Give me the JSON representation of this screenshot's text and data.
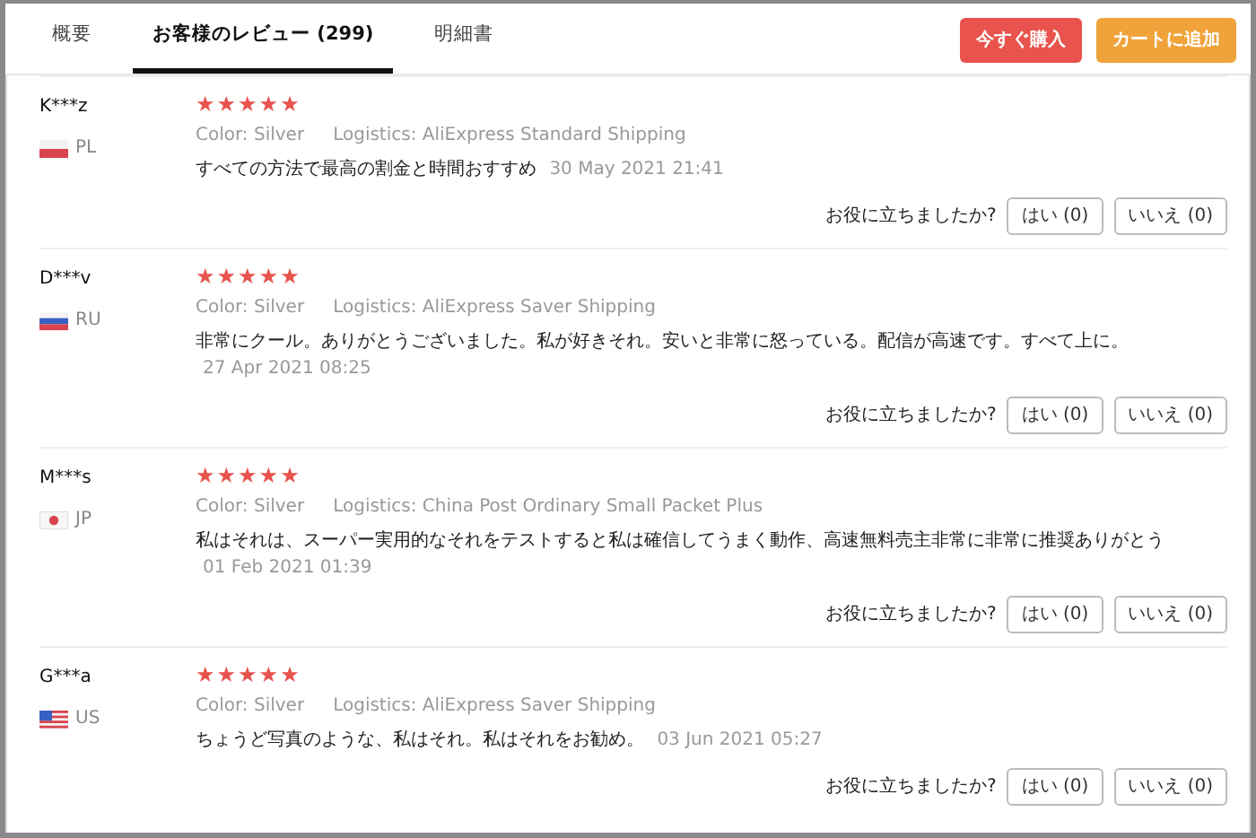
{
  "tabs": [
    {
      "label": "概要",
      "selected": false
    },
    {
      "label": "お客様のレビュー (299)",
      "selected": true
    },
    {
      "label": "明細書",
      "selected": false
    }
  ],
  "actions": [
    {
      "label": "今すぐ購入",
      "kind": "buy"
    },
    {
      "label": "カートに追加",
      "kind": "cart"
    }
  ],
  "reviews": [
    {
      "name": "K***z",
      "kind": "pl",
      "country": "PL",
      "stars": 5,
      "variant": "Color: Silver",
      "logistics": "Logistics: AliExpress Standard Shipping",
      "text": "すべての方法で最高の割金と時間おすすめ",
      "date": "30 May 2021 21:41",
      "helpful": "お役に立ちましたか?",
      "yes": "はい (0)",
      "no": "いいえ (0)"
    },
    {
      "name": "D***v",
      "kind": "ru",
      "country": "RU",
      "stars": 5,
      "variant": "Color: Silver",
      "logistics": "Logistics: AliExpress Saver Shipping",
      "text": "非常にクール。ありがとうございました。私が好きそれ。安いと非常に怒っている。配信が高速です。すべて上に。",
      "date": "27 Apr 2021 08:25",
      "helpful": "お役に立ちましたか?",
      "yes": "はい (0)",
      "no": "いいえ (0)"
    },
    {
      "name": "M***s",
      "kind": "jp",
      "country": "JP",
      "stars": 5,
      "variant": "Color: Silver",
      "logistics": "Logistics: China Post Ordinary Small Packet Plus",
      "text": "私はそれは、スーパー実用的なそれをテストすると私は確信してうまく動作、高速無料売主非常に非常に推奨ありがとう",
      "date": "01 Feb 2021 01:39",
      "helpful": "お役に立ちましたか?",
      "yes": "はい (0)",
      "no": "いいえ (0)"
    },
    {
      "name": "G***a",
      "kind": "us",
      "country": "US",
      "stars": 5,
      "variant": "Color: Silver",
      "logistics": "Logistics: AliExpress Saver Shipping",
      "text": "ちょうど写真のような、私はそれ。私はそれをお勧め。",
      "date": "03 Jun 2021 05:27",
      "helpful": "お役に立ちましたか?",
      "yes": "はい (0)",
      "no": "いいえ (0)"
    }
  ]
}
